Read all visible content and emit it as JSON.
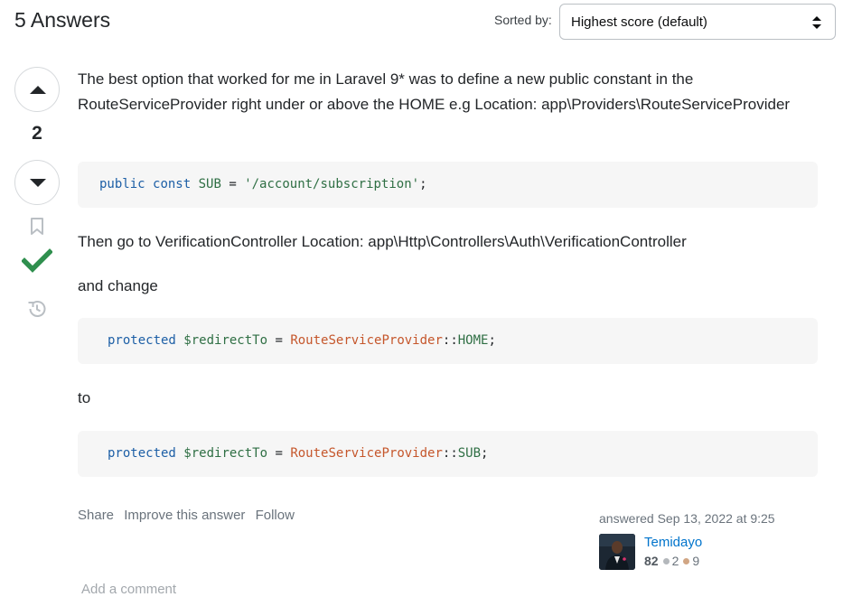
{
  "header": {
    "answers_count": "5 Answers",
    "sort_label": "Sorted by:",
    "sort_selected": "Highest score (default)"
  },
  "vote": {
    "score": "2",
    "accepted": true
  },
  "answer": {
    "paragraph_1": "The best option that worked for me in Laravel 9* was to define a new public constant in the RouteServiceProvider right under or above the HOME e.g Location: app\\Providers\\RouteServiceProvider",
    "code_1": {
      "keyword_1": "public",
      "keyword_2": "const",
      "name": "SUB",
      "op": " = ",
      "string": "'/account/subscription'",
      "end": ";"
    },
    "paragraph_2": "Then go to VerificationController Location: app\\Http\\Controllers\\Auth\\VerificationController",
    "paragraph_3": "and change",
    "code_2": {
      "keyword": "protected",
      "variable": "$redirectTo",
      "op": " = ",
      "class": "RouteServiceProvider",
      "sep": "::",
      "const": "HOME",
      "end": ";"
    },
    "paragraph_4": "to",
    "code_3": {
      "keyword": "protected",
      "variable": "$redirectTo",
      "op": " = ",
      "class": "RouteServiceProvider",
      "sep": "::",
      "const": "SUB",
      "end": ";"
    }
  },
  "post_menu": {
    "share": "Share",
    "improve": "Improve this answer",
    "follow": "Follow"
  },
  "user": {
    "answered_time": "answered Sep 13, 2022 at 9:25",
    "name": "Temidayo",
    "reputation": "82",
    "silver_badges": "2",
    "bronze_badges": "9"
  },
  "comments": {
    "add_comment": "Add a comment"
  },
  "colors": {
    "accepted_green": "#2f8f4e",
    "link_blue": "#0074cc",
    "code_keyword": "#1d5fa6",
    "code_class": "#c5562b"
  },
  "icons": [
    "arrow-up-icon",
    "arrow-down-icon",
    "bookmark-icon",
    "accepted-check-icon",
    "history-icon",
    "sort-arrows-icon"
  ]
}
